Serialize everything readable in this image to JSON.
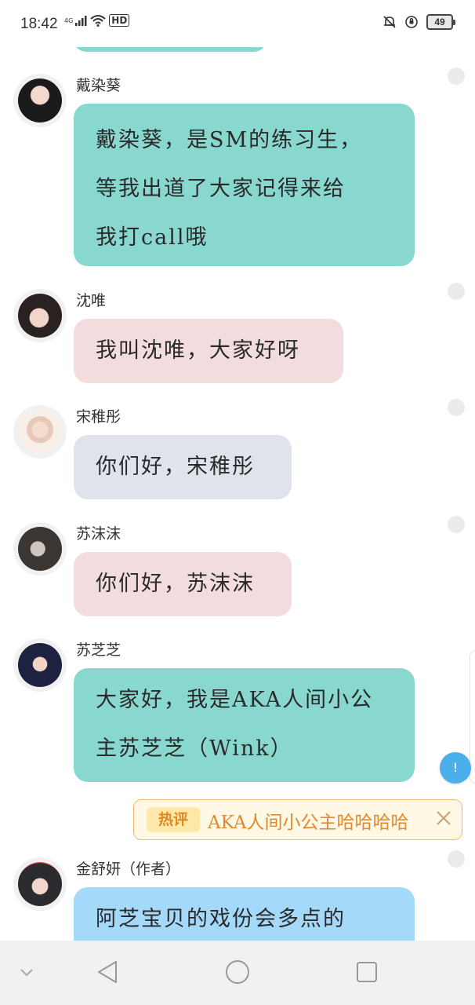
{
  "status_bar": {
    "time": "18:42",
    "network_label": "4G",
    "hd_label": "HD",
    "battery_level": "49",
    "icons": [
      "signal-icon",
      "wifi-icon",
      "hd-icon",
      "mute-icon",
      "alarm-icon",
      "battery-icon"
    ]
  },
  "messages": [
    {
      "name": "戴染葵",
      "lines": [
        "戴染葵，是SM的练习生，",
        "等我出道了大家记得来给",
        "我打call哦"
      ],
      "bubble_color": "#89d8cf"
    },
    {
      "name": "沈唯",
      "lines": [
        "我叫沈唯，大家好呀"
      ],
      "bubble_color": "#f2dcdd"
    },
    {
      "name": "宋稚彤",
      "lines": [
        "你们好，宋稚彤"
      ],
      "bubble_color": "#dfe4ec"
    },
    {
      "name": "苏沫沫",
      "lines": [
        "你们好，苏沫沫"
      ],
      "bubble_color": "#f2dcdd"
    },
    {
      "name": "苏芝芝",
      "lines": [
        "大家好，我是AKA人间小公",
        "主苏芝芝（Wink）"
      ],
      "bubble_color": "#89d8cf"
    },
    {
      "name": "金舒妍（作者）",
      "lines": [
        "阿芝宝贝的戏份会多点的"
      ],
      "bubble_color": "#a4d9f9"
    }
  ],
  "hot_comment": {
    "badge": "热评",
    "text": "AKA人间小公主哈哈哈哈"
  },
  "float_button_label": "!",
  "nav": {
    "items": [
      "collapse-icon",
      "back-icon",
      "home-icon",
      "recents-icon"
    ]
  }
}
